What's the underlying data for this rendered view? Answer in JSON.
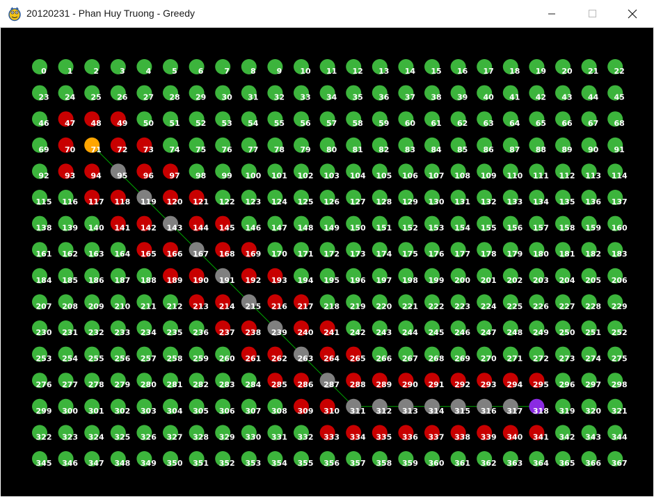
{
  "window": {
    "title": "20120231 - Phan Huy Truong - Greedy",
    "app_icon": "python-icon",
    "controls": [
      {
        "name": "minimize-button",
        "icon": "minimize-icon"
      },
      {
        "name": "maximize-button",
        "icon": "maximize-icon"
      },
      {
        "name": "close-button",
        "icon": "close-icon"
      }
    ]
  },
  "grid": {
    "cols": 23,
    "rows": 16,
    "start": 71,
    "goal": 318,
    "path": [
      71,
      95,
      119,
      143,
      167,
      191,
      215,
      239,
      263,
      287,
      311,
      312,
      313,
      314,
      315,
      316,
      317,
      318
    ],
    "walls": [
      47,
      48,
      49,
      70,
      72,
      73,
      93,
      94,
      96,
      97,
      117,
      118,
      120,
      121,
      141,
      142,
      144,
      145,
      165,
      166,
      168,
      169,
      189,
      190,
      192,
      193,
      213,
      214,
      216,
      217,
      237,
      238,
      240,
      241,
      261,
      262,
      264,
      265,
      285,
      286,
      288,
      289,
      290,
      291,
      292,
      293,
      294,
      295,
      309,
      310,
      333,
      334,
      335,
      336,
      337,
      338,
      339,
      340,
      341
    ]
  },
  "colors": {
    "open": "#3cb43c",
    "wall": "#c80000",
    "path": "#808080",
    "start": "#ffa500",
    "goal": "#8a2be2",
    "line": "#00aa00",
    "label": "#ffffff",
    "background": "#000000"
  }
}
